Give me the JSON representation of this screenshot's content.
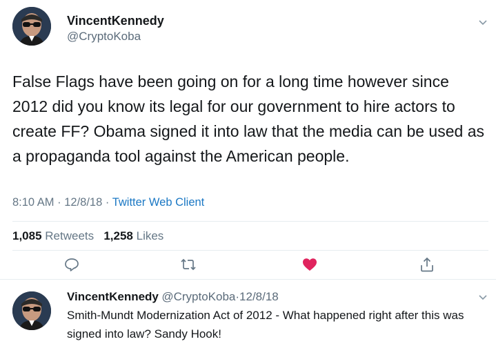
{
  "tweet": {
    "display_name": "VincentKennedy",
    "handle": "@CryptoKoba",
    "text": "False Flags have been going on for a long time however since 2012 did you know its legal for our government to hire actors to create FF? Obama signed it into law that the media can be used as a propaganda tool against the American people.",
    "time": "8:10 AM",
    "date": "12/8/18",
    "source": "Twitter Web Client",
    "separator": "·",
    "retweets_count": "1,085",
    "retweets_label": "Retweets",
    "likes_count": "1,258",
    "likes_label": "Likes"
  },
  "actions": {
    "reply_icon": "reply-icon",
    "retweet_icon": "retweet-icon",
    "like_icon": "heart-icon",
    "share_icon": "share-icon",
    "like_color": "#e0245e",
    "icon_color": "#657786"
  },
  "reply": {
    "display_name": "VincentKennedy",
    "handle": "@CryptoKoba",
    "separator": "·",
    "date": "12/8/18",
    "text": "Smith-Mundt Modernization Act of 2012 - What happened right after this was signed into law? Sandy Hook!"
  }
}
